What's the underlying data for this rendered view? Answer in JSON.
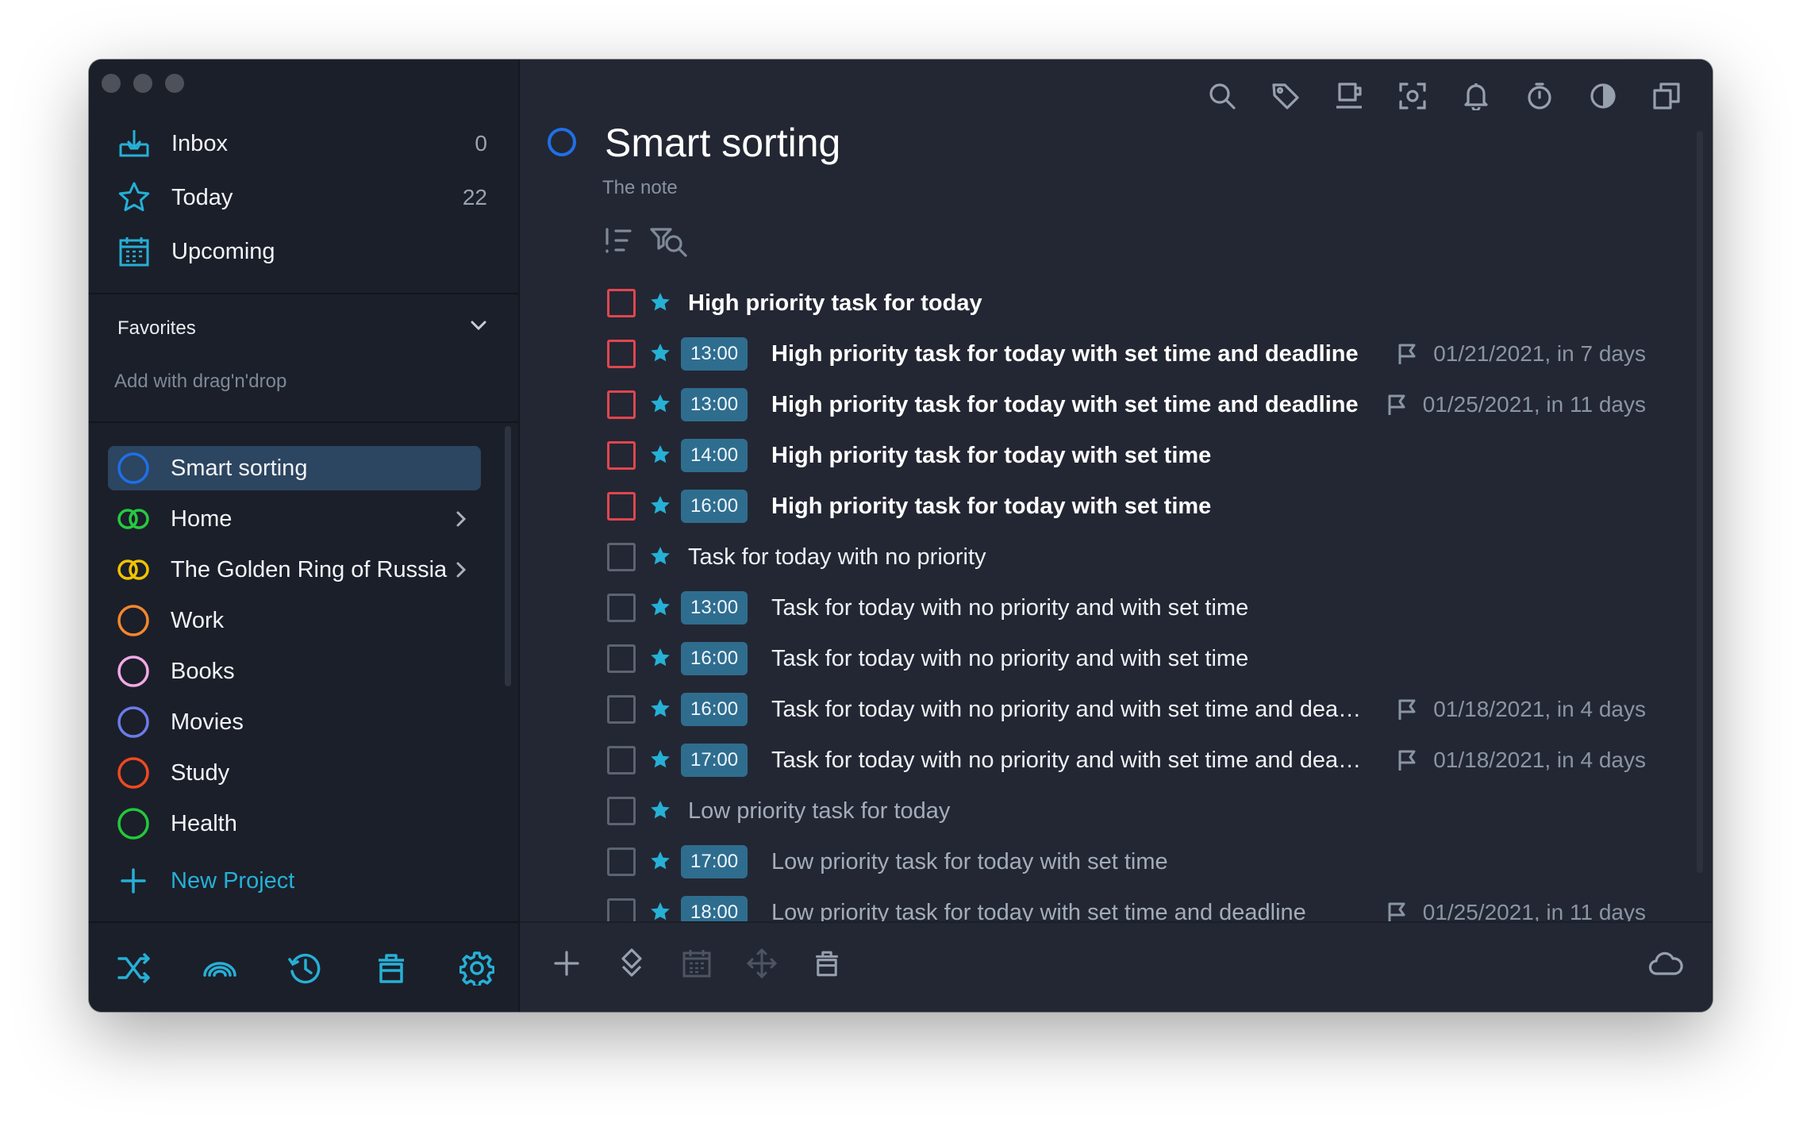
{
  "sidebar": {
    "nav": [
      {
        "label": "Inbox",
        "count": "0",
        "icon": "inbox-icon"
      },
      {
        "label": "Today",
        "count": "22",
        "icon": "star-icon"
      },
      {
        "label": "Upcoming",
        "count": "",
        "icon": "calendar-icon"
      }
    ],
    "favorites_title": "Favorites",
    "favorites_hint": "Add with drag'n'drop",
    "projects": [
      {
        "label": "Smart sorting",
        "color": "#1f6fe8",
        "active": true
      },
      {
        "label": "Home",
        "color": "#27c93f",
        "has_children": true
      },
      {
        "label": "The Golden Ring of Russia",
        "color": "#f2c200",
        "has_children": true
      },
      {
        "label": "Work",
        "color": "#f5872b"
      },
      {
        "label": "Books",
        "color": "#f2a9e6"
      },
      {
        "label": "Movies",
        "color": "#6c7bea"
      },
      {
        "label": "Study",
        "color": "#f0491f"
      },
      {
        "label": "Health",
        "color": "#22c93a"
      }
    ],
    "new_project_label": "New Project",
    "accent": "#26b0d6"
  },
  "main": {
    "title": "Smart sorting",
    "note": "The note",
    "tasks": [
      {
        "time": "",
        "text": "High priority task for today",
        "priority": "high",
        "deadline": ""
      },
      {
        "time": "13:00",
        "text": "High priority task for today with set time and deadline",
        "priority": "high",
        "deadline": "01/21/2021, in 7 days"
      },
      {
        "time": "13:00",
        "text": "High priority task for today with set time and deadline",
        "priority": "high",
        "deadline": "01/25/2021, in 11 days"
      },
      {
        "time": "14:00",
        "text": "High priority task for today with set time",
        "priority": "high",
        "deadline": ""
      },
      {
        "time": "16:00",
        "text": "High priority task for today with set time",
        "priority": "high",
        "deadline": ""
      },
      {
        "time": "",
        "text": "Task for today with no priority",
        "priority": "none",
        "deadline": ""
      },
      {
        "time": "13:00",
        "text": "Task for today with no priority and with set time",
        "priority": "none",
        "deadline": ""
      },
      {
        "time": "16:00",
        "text": "Task for today with no priority and with set time",
        "priority": "none",
        "deadline": ""
      },
      {
        "time": "16:00",
        "text": "Task for today with no priority and with set time and dea…",
        "priority": "none",
        "deadline": "01/18/2021, in 4 days"
      },
      {
        "time": "17:00",
        "text": "Task for today with no priority and with set time and dea…",
        "priority": "none",
        "deadline": "01/18/2021, in 4 days"
      },
      {
        "time": "",
        "text": "Low priority task for today",
        "priority": "low",
        "deadline": ""
      },
      {
        "time": "17:00",
        "text": "Low priority task for today with set time",
        "priority": "low",
        "deadline": ""
      },
      {
        "time": "18:00",
        "text": "Low priority task for today with set time and deadline",
        "priority": "low",
        "deadline": "01/25/2021, in 11 days"
      }
    ]
  },
  "colors": {
    "high_priority": "#e0464f",
    "time_badge": "#2f6d8f",
    "star": "#26b0d6"
  }
}
